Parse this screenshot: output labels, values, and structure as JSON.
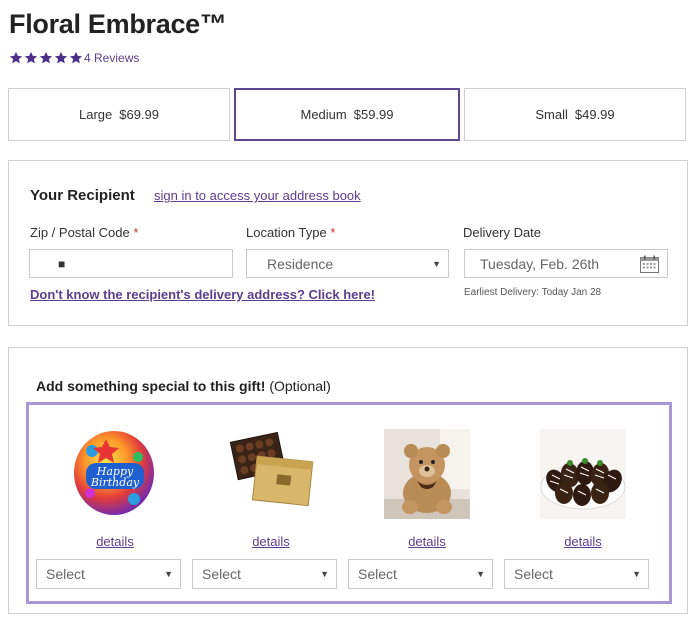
{
  "product": {
    "title": "Floral Embrace™",
    "rating_stars": 5,
    "reviews_text": "4 Reviews",
    "accent_color": "#5c3d8f",
    "star_color": "#4b2f86"
  },
  "sizes": [
    {
      "name": "Large",
      "price": "$69.99",
      "selected": false
    },
    {
      "name": "Medium",
      "price": "$59.99",
      "selected": true
    },
    {
      "name": "Small",
      "price": "$49.99",
      "selected": false
    }
  ],
  "recipient": {
    "heading": "Your Recipient",
    "signin_link": "sign in to access your address book",
    "zip_label": "Zip / Postal Code",
    "zip_value": "■",
    "location_label": "Location Type",
    "location_value": "Residence",
    "required_mark": "*",
    "date_label": "Delivery Date",
    "date_value": "Tuesday, Feb. 26th",
    "address_link": "Don't know the recipient's delivery address? Click here!",
    "earliest_delivery": "Earliest Delivery: Today Jan 28"
  },
  "addons": {
    "heading": "Add something special to this gift!",
    "optional": "(Optional)",
    "items": [
      {
        "image": "birthday-balloon",
        "details": "details",
        "select": "Select"
      },
      {
        "image": "chocolate-box",
        "details": "details",
        "select": "Select"
      },
      {
        "image": "teddy-bear",
        "details": "details",
        "select": "Select"
      },
      {
        "image": "chocolate-strawberries",
        "details": "details",
        "select": "Select"
      }
    ]
  }
}
